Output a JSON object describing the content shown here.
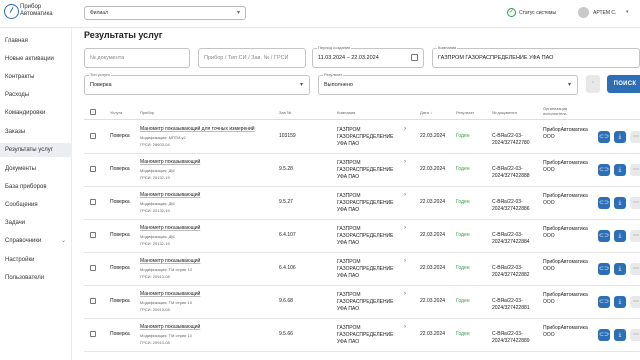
{
  "header": {
    "brand_line1": "Прибор",
    "brand_line2": "Автоматика",
    "filial_value": "Филиал",
    "system_status": "Статус системы",
    "user_name": "АРТЕМ С."
  },
  "sidebar": {
    "items": [
      {
        "label": "Главная"
      },
      {
        "label": "Новые активации"
      },
      {
        "label": "Контракты"
      },
      {
        "label": "Расходы"
      },
      {
        "label": "Командировки"
      },
      {
        "label": "Заказы"
      },
      {
        "label": "Результаты услуг"
      },
      {
        "label": "Документы"
      },
      {
        "label": "База приборов"
      },
      {
        "label": "Сообщения"
      },
      {
        "label": "Задачи"
      },
      {
        "label": "Справочники"
      },
      {
        "label": "Настройки"
      },
      {
        "label": "Пользователи"
      }
    ]
  },
  "page": {
    "title": "Результаты услуг"
  },
  "filters": {
    "doc_number_placeholder": "№ документа",
    "device_placeholder": "Прибор / Тип СИ / Зав. № / ГРСИ",
    "period_label": "Период создания",
    "period_value": "11.03.2024 – 22.03.2024",
    "company_label": "Компания",
    "company_value": "ГАЗПРОМ ГАЗОРАСПРЕДЕЛЕНИЕ УФА ПАО",
    "service_type_label": "Тип услуги",
    "service_type_value": "Поверка",
    "result_label": "Результат",
    "result_value": "Выполнено",
    "search_label": "ПОИСК"
  },
  "table": {
    "headers": {
      "service": "Услуга",
      "device": "Прибор",
      "serial": "Зав №",
      "company": "Компания",
      "date": "Дата",
      "result": "Результат",
      "doc": "№ документа",
      "org_line1": "Организация",
      "org_line2": "исполнитель"
    },
    "rows": [
      {
        "service": "Поверка",
        "device": "Манометр показывающий для точных измерений",
        "mod": "Модификация: МПТИ-у2",
        "grsi": "ГРСИ: 26603-04",
        "serial": "103159",
        "company": [
          "ГАЗПРОМ",
          "ГАЗОРАСПРЕДЕЛЕНИЕ",
          "УФА ПАО"
        ],
        "date": "22.03.2024",
        "result": "Годен",
        "doc": [
          "С-ВЯа/22-03-",
          "2024/327422780"
        ],
        "org": [
          "ПриборАвтоматика",
          "ООО"
        ]
      },
      {
        "service": "Поверка",
        "device": "Манометр показывающий",
        "mod": "Модификация: ДМ",
        "grsi": "ГРСИ: 20132-19",
        "serial": "9.5.28",
        "company": [
          "ГАЗПРОМ",
          "ГАЗОРАСПРЕДЕЛЕНИЕ",
          "УФА ПАО"
        ],
        "date": "22.03.2024",
        "result": "Годен",
        "doc": [
          "С-ВЯа/22-03-",
          "2024/327422888"
        ],
        "org": [
          "ПриборАвтоматика",
          "ООО"
        ]
      },
      {
        "service": "Поверка",
        "device": "Манометр показывающий",
        "mod": "Модификация: ДМ",
        "grsi": "ГРСИ: 20132-19",
        "serial": "9.5.27",
        "company": [
          "ГАЗПРОМ",
          "ГАЗОРАСПРЕДЕЛЕНИЕ",
          "УФА ПАО"
        ],
        "date": "22.03.2024",
        "result": "Годен",
        "doc": [
          "С-ВЯа/22-03-",
          "2024/327422886"
        ],
        "org": [
          "ПриборАвтоматика",
          "ООО"
        ]
      },
      {
        "service": "Поверка",
        "device": "Манометр показывающий",
        "mod": "Модификация: ДМ",
        "grsi": "ГРСИ: 20132-19",
        "serial": "6.4.107",
        "company": [
          "ГАЗПРОМ",
          "ГАЗОРАСПРЕДЕЛЕНИЕ",
          "УФА ПАО"
        ],
        "date": "22.03.2024",
        "result": "Годен",
        "doc": [
          "С-ВЯа/22-03-",
          "2024/327422884"
        ],
        "org": [
          "ПриборАвтоматика",
          "ООО"
        ]
      },
      {
        "service": "Поверка",
        "device": "Манометр показывающий",
        "mod": "Модификация: ТМ серии 10",
        "grsi": "ГРСИ: 20913-08",
        "serial": "6.4.106",
        "company": [
          "ГАЗПРОМ",
          "ГАЗОРАСПРЕДЕЛЕНИЕ",
          "УФА ПАО"
        ],
        "date": "22.03.2024",
        "result": "Годен",
        "doc": [
          "С-ВЯа/22-03-",
          "2024/327422882"
        ],
        "org": [
          "ПриборАвтоматика",
          "ООО"
        ]
      },
      {
        "service": "Поверка",
        "device": "Манометр показывающий",
        "mod": "Модификация: ТМ серии 10",
        "grsi": "ГРСИ: 20913-08",
        "serial": "9.6.68",
        "company": [
          "ГАЗПРОМ",
          "ГАЗОРАСПРЕДЕЛЕНИЕ",
          "УФА ПАО"
        ],
        "date": "22.03.2024",
        "result": "Годен",
        "doc": [
          "С-ВЯа/22-03-",
          "2024/327422881"
        ],
        "org": [
          "ПриборАвтоматика",
          "ООО"
        ]
      },
      {
        "service": "Поверка",
        "device": "Манометр показывающий",
        "mod": "Модификация: ТМ серии 10",
        "grsi": "ГРСИ: 20913-08",
        "serial": "9.5.66",
        "company": [
          "ГАЗПРОМ",
          "ГАЗОРАСПРЕДЕЛЕНИЕ",
          "УФА ПАО"
        ],
        "date": "22.03.2024",
        "result": "Годен",
        "doc": [
          "С-ВЯа/22-03-",
          "2024/327422889"
        ],
        "org": [
          "ПриборАвтоматика",
          "ООО"
        ]
      }
    ]
  },
  "colors": {
    "accent": "#2c6fb6",
    "success": "#2e9e4a",
    "active_nav": "#eaeef3"
  }
}
